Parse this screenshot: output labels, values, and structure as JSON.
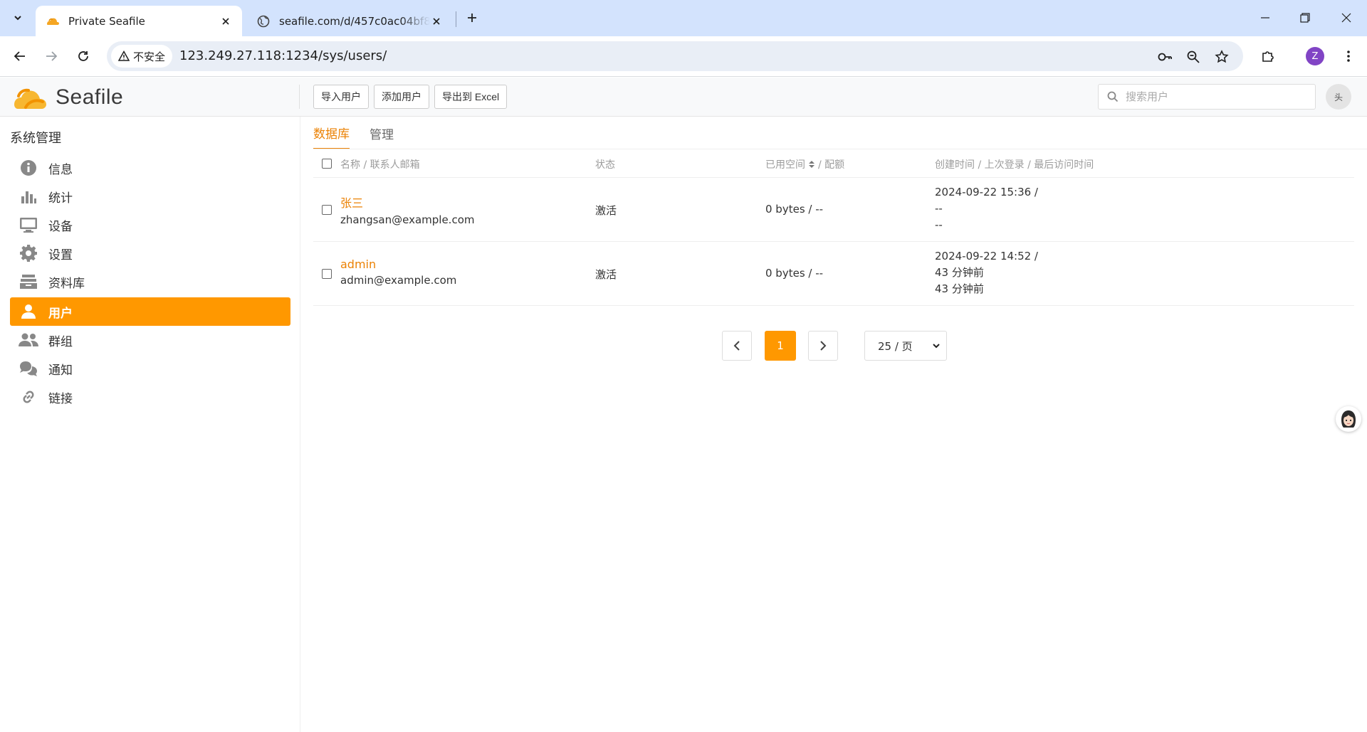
{
  "browser": {
    "tabs": [
      {
        "title": "Private Seafile",
        "active": true
      },
      {
        "title": "seafile.com/d/457c0ac04bf84",
        "active": false
      }
    ],
    "security_label": "不安全",
    "url": "123.249.27.118:1234/sys/users/",
    "profile_initial": "Z"
  },
  "app": {
    "logo_text": "Seafile",
    "header_buttons": {
      "import_users": "导入用户",
      "add_user": "添加用户",
      "export_excel": "导出到 Excel"
    },
    "search": {
      "placeholder": "搜索用户",
      "value": ""
    },
    "avatar_alt": "头"
  },
  "sidebar": {
    "heading": "系统管理",
    "items": [
      {
        "label": "信息",
        "icon": "info-icon"
      },
      {
        "label": "统计",
        "icon": "bar-chart-icon"
      },
      {
        "label": "设备",
        "icon": "monitor-icon"
      },
      {
        "label": "设置",
        "icon": "gear-icon"
      },
      {
        "label": "资料库",
        "icon": "library-icon"
      },
      {
        "label": "用户",
        "icon": "user-icon",
        "active": true
      },
      {
        "label": "群组",
        "icon": "group-icon"
      },
      {
        "label": "通知",
        "icon": "notification-icon"
      },
      {
        "label": "链接",
        "icon": "link-icon"
      }
    ]
  },
  "main": {
    "tabs": [
      {
        "label": "数据库",
        "active": true
      },
      {
        "label": "管理",
        "active": false
      }
    ],
    "table": {
      "headers": {
        "name": "名称 / 联系人邮箱",
        "status": "状态",
        "space": "已用空间",
        "space_suffix": "/ 配额",
        "time": "创建时间 / 上次登录 / 最后访问时间"
      },
      "rows": [
        {
          "name": "张三",
          "email": "zhangsan@example.com",
          "status": "激活",
          "space": "0 bytes / --",
          "created": "2024-09-22 15:36 /",
          "last_login": "--",
          "last_access": "--"
        },
        {
          "name": "admin",
          "email": "admin@example.com",
          "status": "激活",
          "space": "0 bytes / --",
          "created": "2024-09-22 14:52 /",
          "last_login": "43 分钟前",
          "last_access": "43 分钟前"
        }
      ]
    },
    "pagination": {
      "current_page": "1",
      "per_page": "25 / 页"
    }
  },
  "colors": {
    "accent": "#ff9800",
    "link": "#eb8205",
    "browser_tabstrip": "#d3e3fd"
  }
}
